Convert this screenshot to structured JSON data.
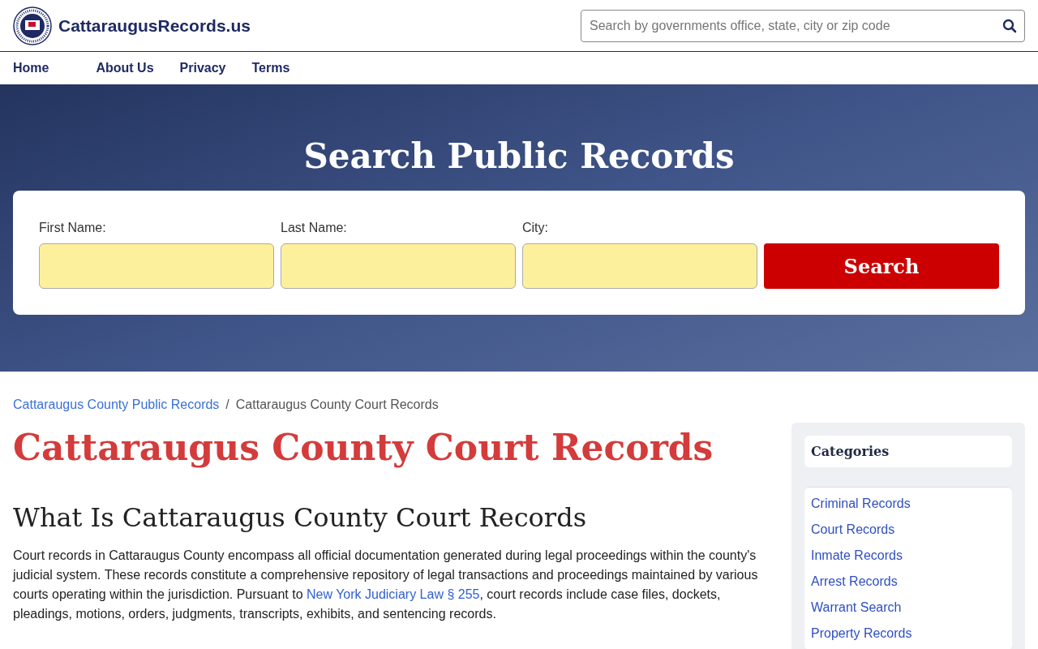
{
  "site": {
    "name": "CattaraugusRecords.us"
  },
  "header_search": {
    "placeholder": "Search by governments office, state, city or zip code"
  },
  "nav": [
    {
      "label": "Home"
    },
    {
      "label": "About Us"
    },
    {
      "label": "Privacy"
    },
    {
      "label": "Terms"
    }
  ],
  "hero": {
    "title": "Search Public Records",
    "fields": [
      {
        "label": "First Name:"
      },
      {
        "label": "Last Name:"
      },
      {
        "label": "City:"
      }
    ],
    "button": "Search"
  },
  "breadcrumb": [
    {
      "label": "Cattaraugus County Public Records",
      "link": true
    },
    {
      "label": "Cattaraugus County Court Records",
      "link": false
    }
  ],
  "breadcrumb_separator": "/",
  "page_title": "Cattaraugus County Court Records",
  "section_heading": "What Is Cattaraugus County Court Records",
  "paragraph": {
    "before": "Court records in Cattaraugus County encompass all official documentation generated during legal proceedings within the county's judicial system. These records constitute a comprehensive repository of legal transactions and proceedings maintained by various courts operating within the jurisdiction. Pursuant to ",
    "link": "New York Judiciary Law § 255",
    "after": ", court records include case files, dockets, pleadings, motions, orders, judgments, transcripts, exhibits, and sentencing records."
  },
  "sidebar": {
    "title": "Categories",
    "items": [
      {
        "label": "Criminal Records"
      },
      {
        "label": "Court Records"
      },
      {
        "label": "Inmate Records"
      },
      {
        "label": "Arrest Records"
      },
      {
        "label": "Warrant Search"
      },
      {
        "label": "Property Records"
      }
    ]
  }
}
